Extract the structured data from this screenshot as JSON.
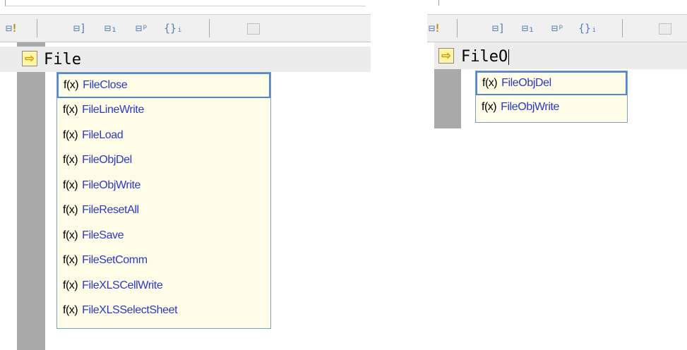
{
  "left_panel": {
    "editor_text": "File",
    "suggestions": [
      {
        "prefix": "f(x)",
        "name": "FileClose",
        "selected": true
      },
      {
        "prefix": "f(x)",
        "name": "FileLineWrite",
        "selected": false
      },
      {
        "prefix": "f(x)",
        "name": "FileLoad",
        "selected": false
      },
      {
        "prefix": "f(x)",
        "name": "FileObjDel",
        "selected": false
      },
      {
        "prefix": "f(x)",
        "name": "FileObjWrite",
        "selected": false
      },
      {
        "prefix": "f(x)",
        "name": "FileResetAll",
        "selected": false
      },
      {
        "prefix": "f(x)",
        "name": "FileSave",
        "selected": false
      },
      {
        "prefix": "f(x)",
        "name": "FileSetComm",
        "selected": false
      },
      {
        "prefix": "f(x)",
        "name": "FileXLSCellWrite",
        "selected": false
      },
      {
        "prefix": "f(x)",
        "name": "FileXLSSelectSheet",
        "selected": false
      }
    ]
  },
  "right_panel": {
    "editor_text": "FileO",
    "suggestions": [
      {
        "prefix": "f(x)",
        "name": "FileObjDel",
        "selected": true
      },
      {
        "prefix": "f(x)",
        "name": "FileObjWrite",
        "selected": false
      }
    ]
  },
  "toolbar": {
    "icons": [
      "run-check-icon",
      "step-into-icon",
      "step-over-icon",
      "step-out-icon",
      "braces-icon",
      "edit-disabled-icon"
    ],
    "glyphs": {
      "doc": "⊟",
      "bang": "!",
      "i1": "⊟]",
      "i2": "⊟₁",
      "i3": "⊟ᵖ",
      "i4": "{}ᵢ"
    }
  },
  "colors": {
    "suggestion_text": "#2b39c9",
    "popup_bg": "#fffde8",
    "selection_border": "#4f86d9",
    "gutter": "#a9a9a9",
    "marker": "#fff4a8"
  }
}
